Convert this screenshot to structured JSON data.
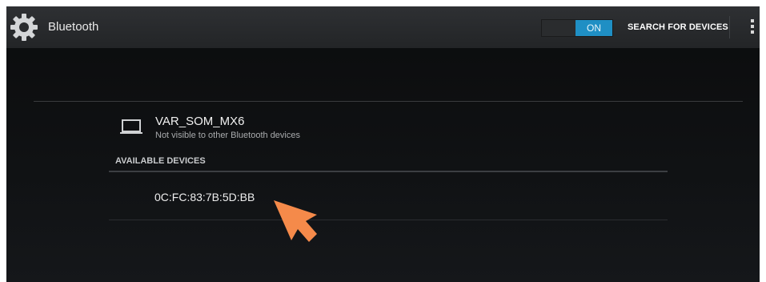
{
  "actionbar": {
    "title": "Bluetooth",
    "toggle_label": "ON",
    "search_label": "SEARCH FOR DEVICES",
    "icons": [
      "gear-icon",
      "overflow-menu-icon"
    ]
  },
  "local_device": {
    "name": "VAR_SOM_MX6",
    "status": "Not visible to other Bluetooth devices",
    "icon": "laptop-icon"
  },
  "available": {
    "header": "AVAILABLE DEVICES",
    "devices": [
      {
        "name": "0C:FC:83:7B:5D:BB"
      }
    ]
  },
  "colors": {
    "toggle_on": "#1f8fc4",
    "cursor": "#f58a4a",
    "background": "#0e1012"
  }
}
